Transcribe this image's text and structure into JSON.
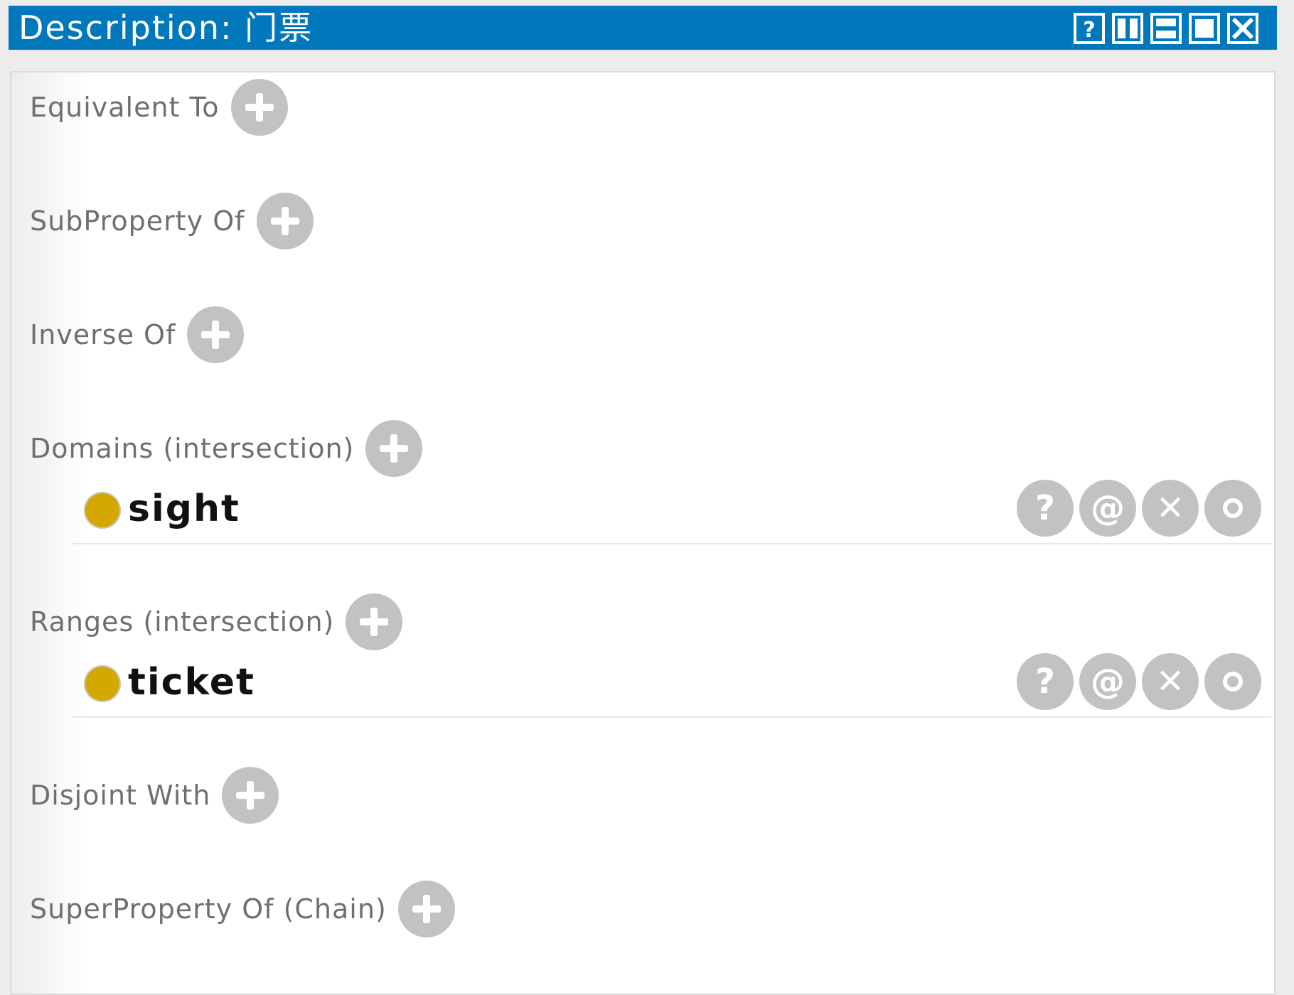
{
  "window": {
    "title": "Description: 门票",
    "buttons": [
      "help-icon",
      "split-vertical-icon",
      "split-horizontal-icon",
      "maximize-icon",
      "close-icon"
    ]
  },
  "sections": [
    {
      "label": "Equivalent To"
    },
    {
      "label": "SubProperty Of"
    },
    {
      "label": "Inverse Of"
    },
    {
      "label": "Domains (intersection)",
      "entries": [
        {
          "name": "sight"
        }
      ]
    },
    {
      "label": "Ranges (intersection)",
      "entries": [
        {
          "name": "ticket"
        }
      ]
    },
    {
      "label": "Disjoint With"
    },
    {
      "label": "SuperProperty Of (Chain)"
    }
  ],
  "entry_actions": {
    "explain": "?",
    "annotate": "@",
    "delete": "✕",
    "edit": "edit-ring-icon"
  },
  "colors": {
    "title_bar": "#0078bb",
    "class_dot": "#d5a800",
    "button_gray": "#c2c2c2",
    "label_gray": "#6f6f6f"
  }
}
